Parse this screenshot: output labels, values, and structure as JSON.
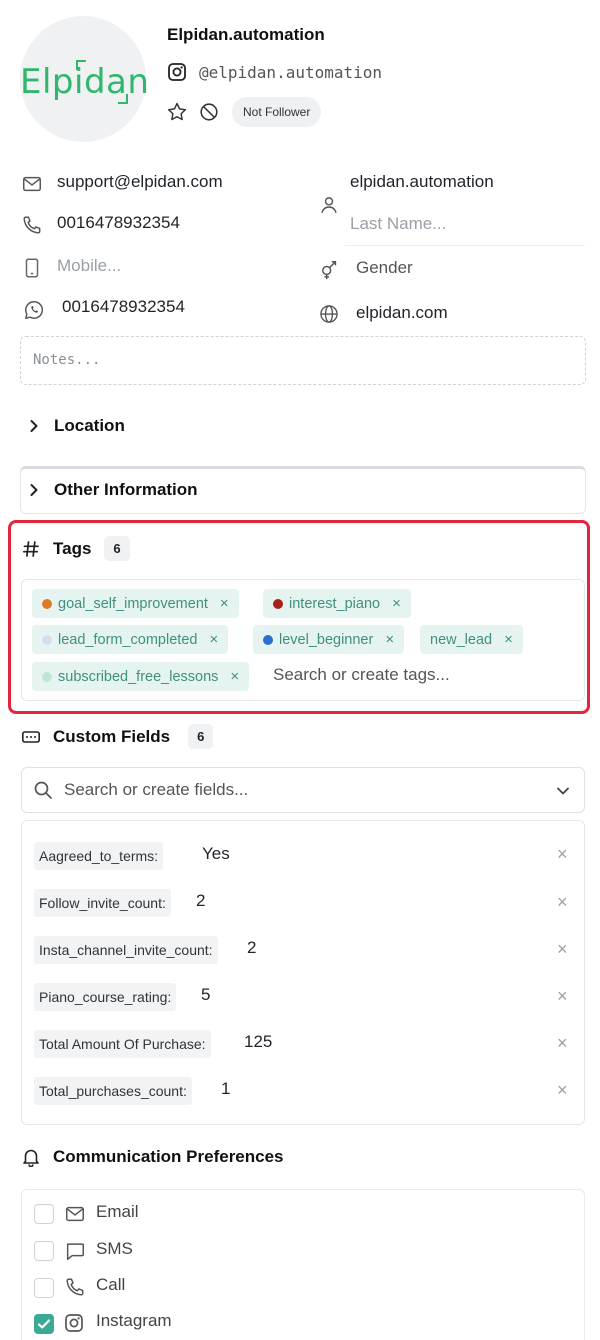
{
  "profile": {
    "avatar_logo": "Elpidan",
    "name": "Elpidan.automation",
    "handle": "@elpidan.automation",
    "follow_status": "Not Follower"
  },
  "contact": {
    "email": "support@elpidan.com",
    "phone": "0016478932354",
    "mobile_placeholder": "Mobile...",
    "whatsapp": "0016478932354",
    "first_name": "elpidan.automation",
    "last_name_placeholder": "Last Name...",
    "gender_placeholder": "Gender",
    "website": "elpidan.com",
    "notes_placeholder": "Notes..."
  },
  "sections": {
    "location": "Location",
    "other_information": "Other Information",
    "tags": "Tags",
    "tags_count": "6",
    "custom_fields": "Custom Fields",
    "custom_fields_count": "6",
    "communication": "Communication Preferences"
  },
  "tags": [
    {
      "label": "goal_self_improvement",
      "dot": "#e07a2a"
    },
    {
      "label": "interest_piano",
      "dot": "#a8201a"
    },
    {
      "label": "lead_form_completed",
      "dot": "#d9dcef"
    },
    {
      "label": "level_beginner",
      "dot": "#2d6fcf"
    },
    {
      "label": "new_lead",
      "dot": ""
    },
    {
      "label": "subscribed_free_lessons",
      "dot": "#bfe6d5"
    }
  ],
  "tag_remove_symbol": "×",
  "tag_search_placeholder": "Search or create tags...",
  "field_search_placeholder": "Search or create fields...",
  "custom_fields": [
    {
      "label": "Aagreed_to_terms:",
      "value": "Yes"
    },
    {
      "label": "Follow_invite_count:",
      "value": "2"
    },
    {
      "label": "Insta_channel_invite_count:",
      "value": "2"
    },
    {
      "label": "Piano_course_rating:",
      "value": "5"
    },
    {
      "label": "Total Amount Of Purchase:",
      "value": "125"
    },
    {
      "label": "Total_purchases_count:",
      "value": "1"
    }
  ],
  "field_remove_symbol": "×",
  "communication": [
    {
      "label": "Email",
      "checked": false
    },
    {
      "label": "SMS",
      "checked": false
    },
    {
      "label": "Call",
      "checked": false
    },
    {
      "label": "Instagram",
      "checked": true
    }
  ],
  "colors": {
    "accent": "#3aaa94",
    "highlight": "#e3253d",
    "brand": "#2fb86d"
  }
}
